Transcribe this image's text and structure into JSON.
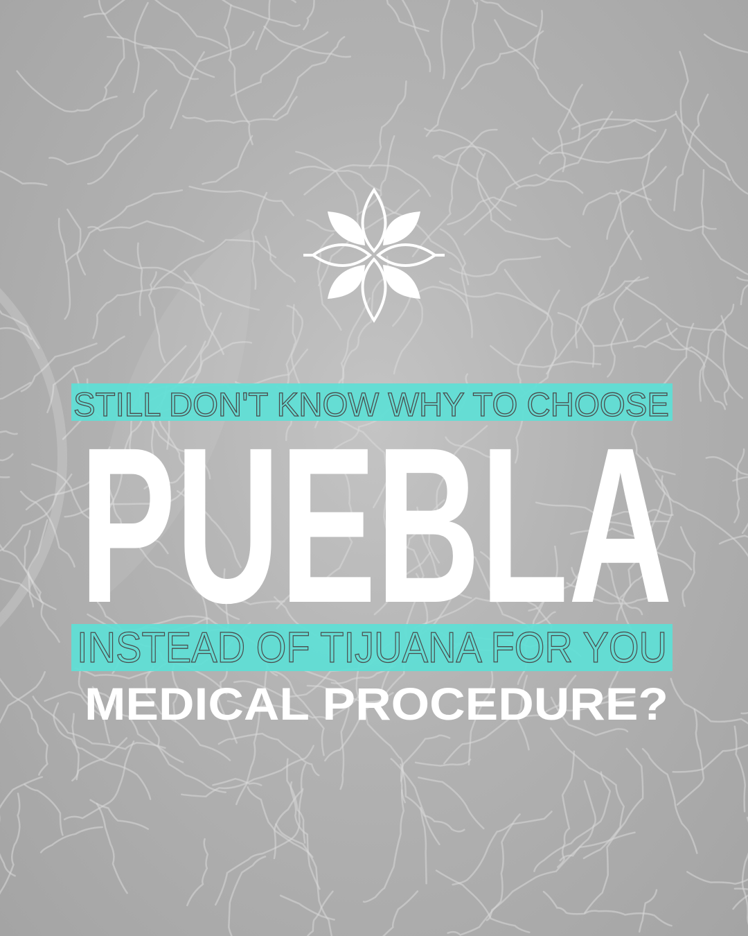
{
  "headline": {
    "line1": "STILL DON'T KNOW WHY TO CHOOSE",
    "main": "PUEBLA",
    "line2": "INSTEAD OF TIJUANA FOR YOU",
    "line3": "MEDICAL PROCEDURE?"
  },
  "logo": {
    "icon": "flower-logo-icon"
  },
  "colors": {
    "highlight": "#5ddfd6",
    "thin_text": "#4a4a4a",
    "bold_text": "#ffffff",
    "background": "#b2b2b2"
  }
}
